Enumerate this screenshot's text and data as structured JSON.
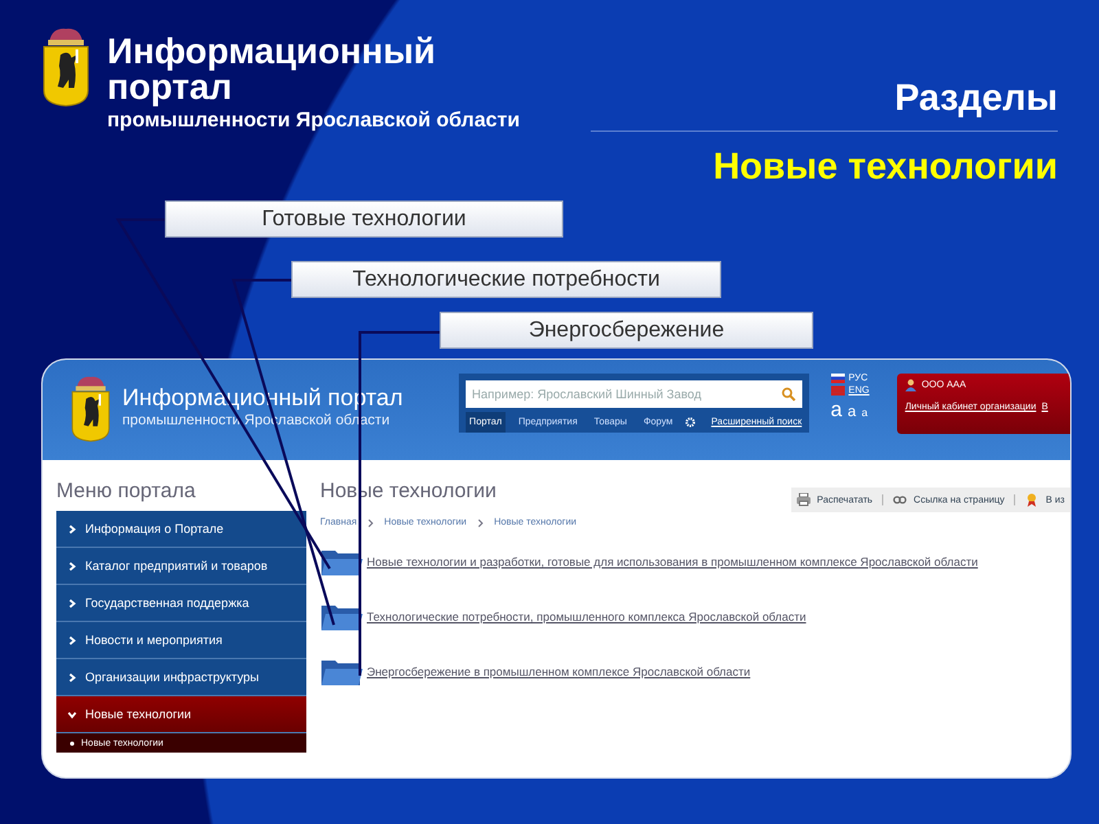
{
  "slide": {
    "title": "Информационный портал",
    "subtitle": "промышленности Ярославской области",
    "section_label": "Разделы",
    "section_title": "Новые технологии"
  },
  "callouts": [
    "Готовые технологии",
    "Технологические потребности",
    "Энергосбережение"
  ],
  "portal": {
    "title": "Информационный портал",
    "subtitle": "промышленности Ярославской области",
    "search": {
      "placeholder": "Например: Ярославский Шинный Завод"
    },
    "search_tabs": [
      {
        "label": "Портал",
        "selected": true
      },
      {
        "label": "Предприятия",
        "selected": false
      },
      {
        "label": "Товары",
        "selected": false
      },
      {
        "label": "Форум",
        "selected": false
      }
    ],
    "advanced_search": "Расширенный поиск",
    "languages": [
      "РУС",
      "ENG"
    ],
    "font_sizes": [
      "а",
      "а",
      "а"
    ],
    "user": "ООО ААА",
    "user_links": [
      "Личный кабинет организации",
      "В"
    ],
    "menu": {
      "title": "Меню портала",
      "items": [
        {
          "label": "Информация о Портале",
          "expanded": false
        },
        {
          "label": "Каталог предприятий и товаров",
          "expanded": false
        },
        {
          "label": "Государственная поддержка",
          "expanded": false
        },
        {
          "label": "Новости и мероприятия",
          "expanded": false
        },
        {
          "label": "Организации инфраструктуры",
          "expanded": false
        },
        {
          "label": "Новые технологии",
          "expanded": true,
          "children": [
            {
              "label": "Новые технологии"
            }
          ]
        }
      ]
    },
    "page_title": "Новые технологии",
    "toolbar": [
      "Распечатать",
      "Ссылка на страницу",
      "В из"
    ],
    "breadcrumbs": [
      "Главная",
      "Новые технологии",
      "Новые технологии"
    ],
    "folders": [
      "Новые технологии и разработки, готовые для использования в промышленном комплексе Ярославской области",
      "Технологические потребности, промышленного комплекса Ярославской области",
      "Энергосбережение в промышленном комплексе Ярославской области"
    ]
  }
}
